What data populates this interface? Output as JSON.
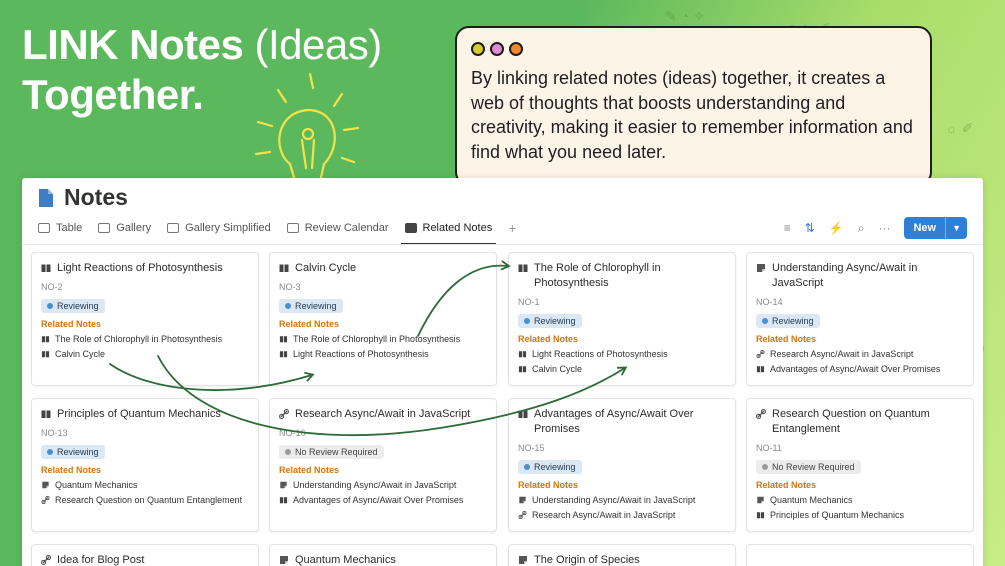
{
  "hero": {
    "line1_prefix": "LINK Notes",
    "paren": "(Ideas)",
    "line2": "Together."
  },
  "callout": {
    "text": "By linking related notes (ideas) together, it creates a web of thoughts that boosts understanding and creativity, making it easier to remember information and find what you need later.",
    "dot_colors": [
      "#d9c935",
      "#e08ad8",
      "#f2882e"
    ]
  },
  "app": {
    "title": "Notes",
    "tabs": [
      {
        "label": "Table",
        "icon": "table-icon"
      },
      {
        "label": "Gallery",
        "icon": "gallery-icon"
      },
      {
        "label": "Gallery Simplified",
        "icon": "gallery-icon"
      },
      {
        "label": "Review Calendar",
        "icon": "calendar-icon"
      },
      {
        "label": "Related Notes",
        "icon": "related-notes-icon",
        "active": true
      }
    ],
    "add_tab": "+",
    "new_label": "New",
    "related_label": "Related Notes",
    "cards": [
      {
        "title": "Light Reactions of Photosynthesis",
        "icon": "book-icon",
        "no": "NO-2",
        "status": "Reviewing",
        "related": [
          {
            "icon": "book-icon",
            "label": "The Role of Chlorophyll in Photosynthesis"
          },
          {
            "icon": "book-icon",
            "label": "Calvin Cycle"
          }
        ]
      },
      {
        "title": "Calvin Cycle",
        "icon": "book-icon",
        "no": "NO-3",
        "status": "Reviewing",
        "related": [
          {
            "icon": "book-icon",
            "label": "The Role of Chlorophyll in Photosynthesis"
          },
          {
            "icon": "book-icon",
            "label": "Light Reactions of Photosynthesis"
          }
        ]
      },
      {
        "title": "The Role of Chlorophyll in Photosynthesis",
        "icon": "book-icon",
        "no": "NO-1",
        "status": "Reviewing",
        "related": [
          {
            "icon": "book-icon",
            "label": "Light Reactions of Photosynthesis"
          },
          {
            "icon": "book-icon",
            "label": "Calvin Cycle"
          }
        ]
      },
      {
        "title": "Understanding Async/Await in JavaScript",
        "icon": "note-icon",
        "no": "NO-14",
        "status": "Reviewing",
        "related": [
          {
            "icon": "link-icon",
            "label": "Research Async/Await in JavaScript"
          },
          {
            "icon": "book-icon",
            "label": "Advantages of Async/Await Over Promises"
          }
        ]
      },
      {
        "title": "Principles of Quantum Mechanics",
        "icon": "book-icon",
        "no": "NO-13",
        "status": "Reviewing",
        "related": [
          {
            "icon": "note-icon",
            "label": "Quantum Mechanics"
          },
          {
            "icon": "link-icon",
            "label": "Research Question on Quantum Entanglement"
          }
        ]
      },
      {
        "title": "Research Async/Await in JavaScript",
        "icon": "link-icon",
        "no": "NO-16",
        "status": "No Review Required",
        "related": [
          {
            "icon": "note-icon",
            "label": "Understanding Async/Await in JavaScript"
          },
          {
            "icon": "book-icon",
            "label": "Advantages of Async/Await Over Promises"
          }
        ]
      },
      {
        "title": "Advantages of Async/Await Over Promises",
        "icon": "book-icon",
        "no": "NO-15",
        "status": "Reviewing",
        "related": [
          {
            "icon": "note-icon",
            "label": "Understanding Async/Await in JavaScript"
          },
          {
            "icon": "link-icon",
            "label": "Research Async/Await in JavaScript"
          }
        ]
      },
      {
        "title": "Research Question on Quantum Entanglement",
        "icon": "link-icon",
        "no": "NO-11",
        "status": "No Review Required",
        "related": [
          {
            "icon": "note-icon",
            "label": "Quantum Mechanics"
          },
          {
            "icon": "book-icon",
            "label": "Principles of Quantum Mechanics"
          }
        ]
      },
      {
        "title": "Idea for Blog Post",
        "icon": "link-icon",
        "no": "",
        "status": "",
        "related": []
      },
      {
        "title": "Quantum Mechanics",
        "icon": "note-icon",
        "no": "",
        "status": "",
        "related": []
      },
      {
        "title": "The Origin of Species",
        "icon": "note-icon",
        "no": "",
        "status": "",
        "related": []
      },
      {
        "title": "",
        "icon": "",
        "no": "",
        "status": "",
        "related": []
      }
    ]
  },
  "colors": {
    "bg_green": "#5cb85c",
    "accent_blue": "#2f7fd5",
    "related_orange": "#d9730d",
    "arrow_green": "#2e6b3a"
  }
}
